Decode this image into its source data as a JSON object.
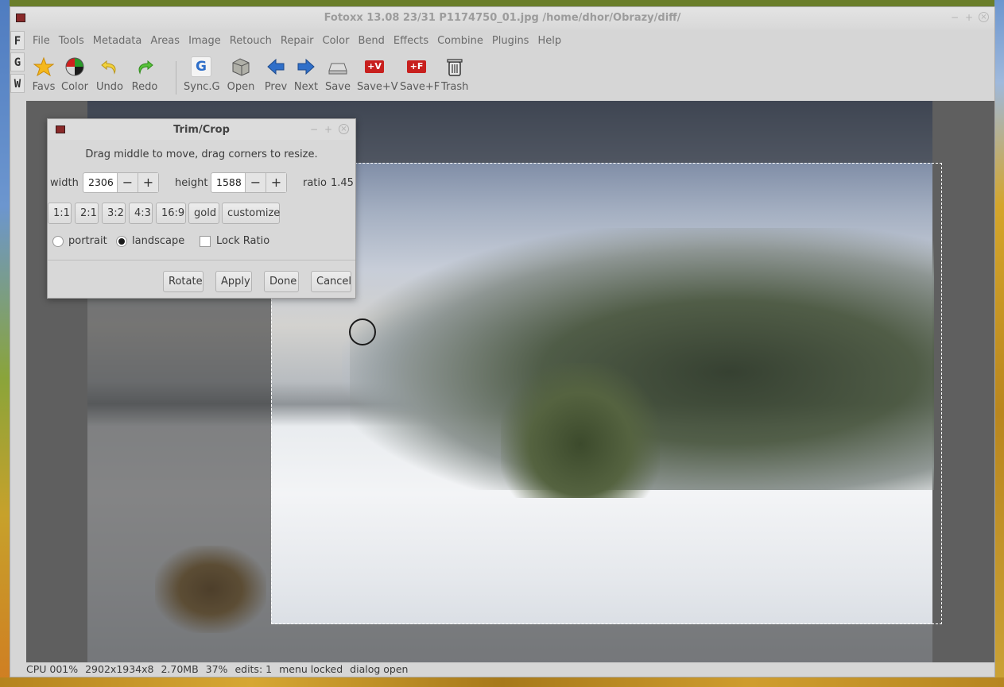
{
  "window": {
    "title": "Fotoxx 13.08  23/31  P1174750_01.jpg  /home/dhor/Obrazy/diff/"
  },
  "side_tabs": [
    "F",
    "G",
    "W"
  ],
  "menubar": [
    "File",
    "Tools",
    "Metadata",
    "Areas",
    "Image",
    "Retouch",
    "Repair",
    "Color",
    "Bend",
    "Effects",
    "Combine",
    "Plugins",
    "Help"
  ],
  "toolbar": {
    "favs": "Favs",
    "color": "Color",
    "undo": "Undo",
    "redo": "Redo",
    "sync": "Sync.G",
    "open": "Open",
    "prev": "Prev",
    "next": "Next",
    "save": "Save",
    "savev": "Save+V",
    "savef": "Save+F",
    "trash": "Trash"
  },
  "icons": {
    "favs": "star-icon",
    "color": "color-wheel-icon",
    "undo": "undo-arrow-icon",
    "redo": "redo-arrow-icon",
    "sync": "sync-g-icon",
    "open": "open-folder-icon",
    "prev": "arrow-left-icon",
    "next": "arrow-right-icon",
    "save": "save-disk-icon",
    "savev": "save-version-icon",
    "savef": "save-file-icon",
    "trash": "trash-icon",
    "sync_glyph": "G",
    "savev_glyph": "+V",
    "savef_glyph": "+F"
  },
  "statusbar": {
    "cpu": "CPU 001%",
    "dims": "2902x1934x8",
    "size": "2.70MB",
    "zoom": "37%",
    "edits": "edits: 1",
    "menu": "menu locked",
    "dialog": "dialog open"
  },
  "dialog": {
    "title": "Trim/Crop",
    "instruction": "Drag middle to move, drag corners to resize.",
    "width_label": "width",
    "width_value": "2306",
    "height_label": "height",
    "height_value": "1588",
    "ratio_label": "ratio",
    "ratio_value": "1.45",
    "minus": "−",
    "plus": "+",
    "presets": [
      "1:1",
      "2:1",
      "3:2",
      "4:3",
      "16:9",
      "gold",
      "customize"
    ],
    "portrait": "portrait",
    "landscape": "landscape",
    "lock_ratio": "Lock Ratio",
    "rotate": "Rotate",
    "apply": "Apply",
    "done": "Done",
    "cancel": "Cancel"
  },
  "colors": {
    "accent_red": "#c8201e",
    "arrow_blue": "#2f6fc9",
    "star": "#f5b81c"
  }
}
